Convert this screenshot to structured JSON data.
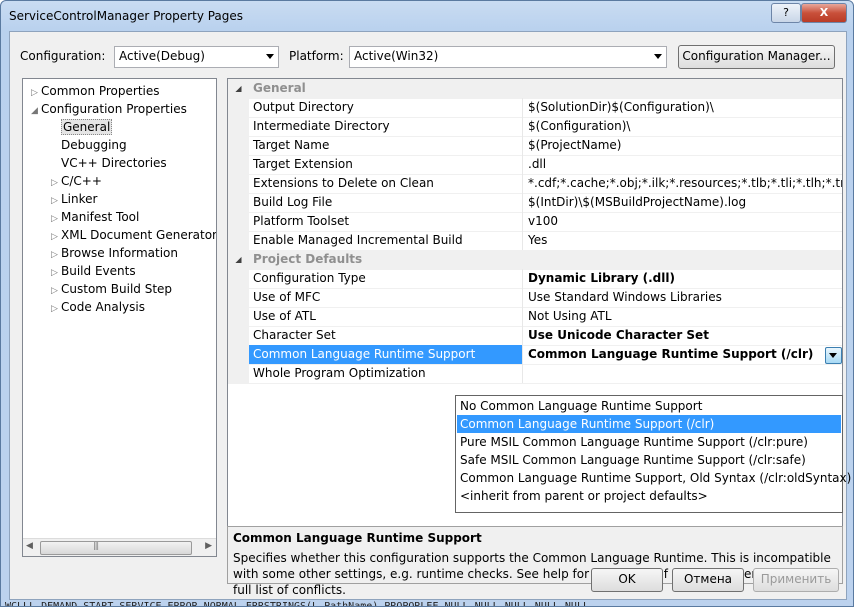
{
  "window": {
    "title": "ServiceControlManager Property Pages",
    "help_label": "?",
    "close_label": "X"
  },
  "toolbar": {
    "configuration_label": "Configuration:",
    "configuration_value": "Active(Debug)",
    "platform_label": "Platform:",
    "platform_value": "Active(Win32)",
    "config_manager_label": "Configuration Manager..."
  },
  "tree": {
    "items": [
      {
        "label": "Common Properties",
        "expander": "▷"
      },
      {
        "label": "Configuration Properties",
        "expander": "◢"
      },
      {
        "label": "General",
        "expander": ""
      },
      {
        "label": "Debugging",
        "expander": ""
      },
      {
        "label": "VC++ Directories",
        "expander": ""
      },
      {
        "label": "C/C++",
        "expander": "▷"
      },
      {
        "label": "Linker",
        "expander": "▷"
      },
      {
        "label": "Manifest Tool",
        "expander": "▷"
      },
      {
        "label": "XML Document Generator",
        "expander": "▷"
      },
      {
        "label": "Browse Information",
        "expander": "▷"
      },
      {
        "label": "Build Events",
        "expander": "▷"
      },
      {
        "label": "Custom Build Step",
        "expander": "▷"
      },
      {
        "label": "Code Analysis",
        "expander": "▷"
      }
    ]
  },
  "grid": {
    "rows": [
      {
        "name": "General",
        "value": "",
        "category": true
      },
      {
        "name": "Output Directory",
        "value": "$(SolutionDir)$(Configuration)\\"
      },
      {
        "name": "Intermediate Directory",
        "value": "$(Configuration)\\"
      },
      {
        "name": "Target Name",
        "value": "$(ProjectName)"
      },
      {
        "name": "Target Extension",
        "value": ".dll"
      },
      {
        "name": "Extensions to Delete on Clean",
        "value": "*.cdf;*.cache;*.obj;*.ilk;*.resources;*.tlb;*.tli;*.tlh;*.tmp;*.rsp;*"
      },
      {
        "name": "Build Log File",
        "value": "$(IntDir)\\$(MSBuildProjectName).log"
      },
      {
        "name": "Platform Toolset",
        "value": "v100"
      },
      {
        "name": "Enable Managed Incremental Build",
        "value": "Yes"
      },
      {
        "name": "Project Defaults",
        "value": "",
        "category": true
      },
      {
        "name": "Configuration Type",
        "value": "Dynamic Library (.dll)",
        "bold": true
      },
      {
        "name": "Use of MFC",
        "value": "Use Standard Windows Libraries"
      },
      {
        "name": "Use of ATL",
        "value": "Not Using ATL"
      },
      {
        "name": "Character Set",
        "value": "Use Unicode Character Set",
        "bold": true
      },
      {
        "name": "Common Language Runtime Support",
        "value": "Common Language Runtime Support (/clr)",
        "bold": true,
        "selected": true
      },
      {
        "name": "Whole Program Optimization",
        "value": ""
      }
    ]
  },
  "dropdown": {
    "options": [
      "No Common Language Runtime Support",
      "Common Language Runtime Support (/clr)",
      "Pure MSIL Common Language Runtime Support (/clr:pure)",
      "Safe MSIL Common Language Runtime Support (/clr:safe)",
      "Common Language Runtime Support, Old Syntax (/clr:oldSyntax)",
      "<inherit from parent or project defaults>"
    ],
    "highlighted": 1
  },
  "description": {
    "title": "Common Language Runtime Support",
    "text": "Specifies whether this configuration supports the Common Language Runtime. This is incompatible with some other settings, e.g. runtime checks. See help for /clr family of C++ compiler switches for full list of conflicts."
  },
  "buttons": {
    "ok": "OK",
    "cancel": "Отмена",
    "apply": "Применить"
  },
  "background_text": "WCLLL DEMAND START SERVICE ERROR NORMAL ERRSTRINGS(L PathName) PROPORLEE NULL NULL NULL NULL NULL"
}
